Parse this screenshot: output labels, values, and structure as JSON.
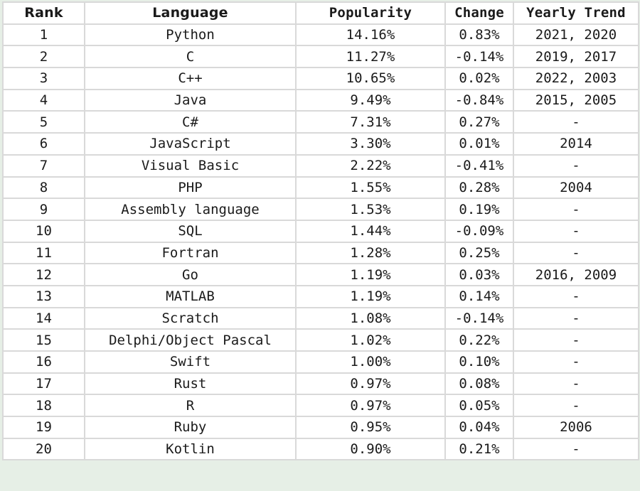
{
  "table": {
    "headers": {
      "rank": "Rank",
      "language": "Language",
      "popularity": "Popularity",
      "change": "Change",
      "yearly_trend": "Yearly Trend"
    },
    "rows": [
      {
        "rank": "1",
        "language": "Python",
        "popularity": "14.16%",
        "change": "0.83%",
        "yearly_trend": "2021, 2020"
      },
      {
        "rank": "2",
        "language": "C",
        "popularity": "11.27%",
        "change": "-0.14%",
        "yearly_trend": "2019, 2017"
      },
      {
        "rank": "3",
        "language": "C++",
        "popularity": "10.65%",
        "change": "0.02%",
        "yearly_trend": "2022, 2003"
      },
      {
        "rank": "4",
        "language": "Java",
        "popularity": "9.49%",
        "change": "-0.84%",
        "yearly_trend": "2015, 2005"
      },
      {
        "rank": "5",
        "language": "C#",
        "popularity": "7.31%",
        "change": "0.27%",
        "yearly_trend": "-"
      },
      {
        "rank": "6",
        "language": "JavaScript",
        "popularity": "3.30%",
        "change": "0.01%",
        "yearly_trend": "2014"
      },
      {
        "rank": "7",
        "language": "Visual Basic",
        "popularity": "2.22%",
        "change": "-0.41%",
        "yearly_trend": "-"
      },
      {
        "rank": "8",
        "language": "PHP",
        "popularity": "1.55%",
        "change": "0.28%",
        "yearly_trend": "2004"
      },
      {
        "rank": "9",
        "language": "Assembly language",
        "popularity": "1.53%",
        "change": "0.19%",
        "yearly_trend": "-"
      },
      {
        "rank": "10",
        "language": "SQL",
        "popularity": "1.44%",
        "change": "-0.09%",
        "yearly_trend": "-"
      },
      {
        "rank": "11",
        "language": "Fortran",
        "popularity": "1.28%",
        "change": "0.25%",
        "yearly_trend": "-"
      },
      {
        "rank": "12",
        "language": "Go",
        "popularity": "1.19%",
        "change": "0.03%",
        "yearly_trend": "2016, 2009"
      },
      {
        "rank": "13",
        "language": "MATLAB",
        "popularity": "1.19%",
        "change": "0.14%",
        "yearly_trend": "-"
      },
      {
        "rank": "14",
        "language": "Scratch",
        "popularity": "1.08%",
        "change": "-0.14%",
        "yearly_trend": "-"
      },
      {
        "rank": "15",
        "language": "Delphi/Object Pascal",
        "popularity": "1.02%",
        "change": "0.22%",
        "yearly_trend": "-"
      },
      {
        "rank": "16",
        "language": "Swift",
        "popularity": "1.00%",
        "change": "0.10%",
        "yearly_trend": "-"
      },
      {
        "rank": "17",
        "language": "Rust",
        "popularity": "0.97%",
        "change": "0.08%",
        "yearly_trend": "-"
      },
      {
        "rank": "18",
        "language": "R",
        "popularity": "0.97%",
        "change": "0.05%",
        "yearly_trend": "-"
      },
      {
        "rank": "19",
        "language": "Ruby",
        "popularity": "0.95%",
        "change": "0.04%",
        "yearly_trend": "2006"
      },
      {
        "rank": "20",
        "language": "Kotlin",
        "popularity": "0.90%",
        "change": "0.21%",
        "yearly_trend": "-"
      }
    ]
  }
}
